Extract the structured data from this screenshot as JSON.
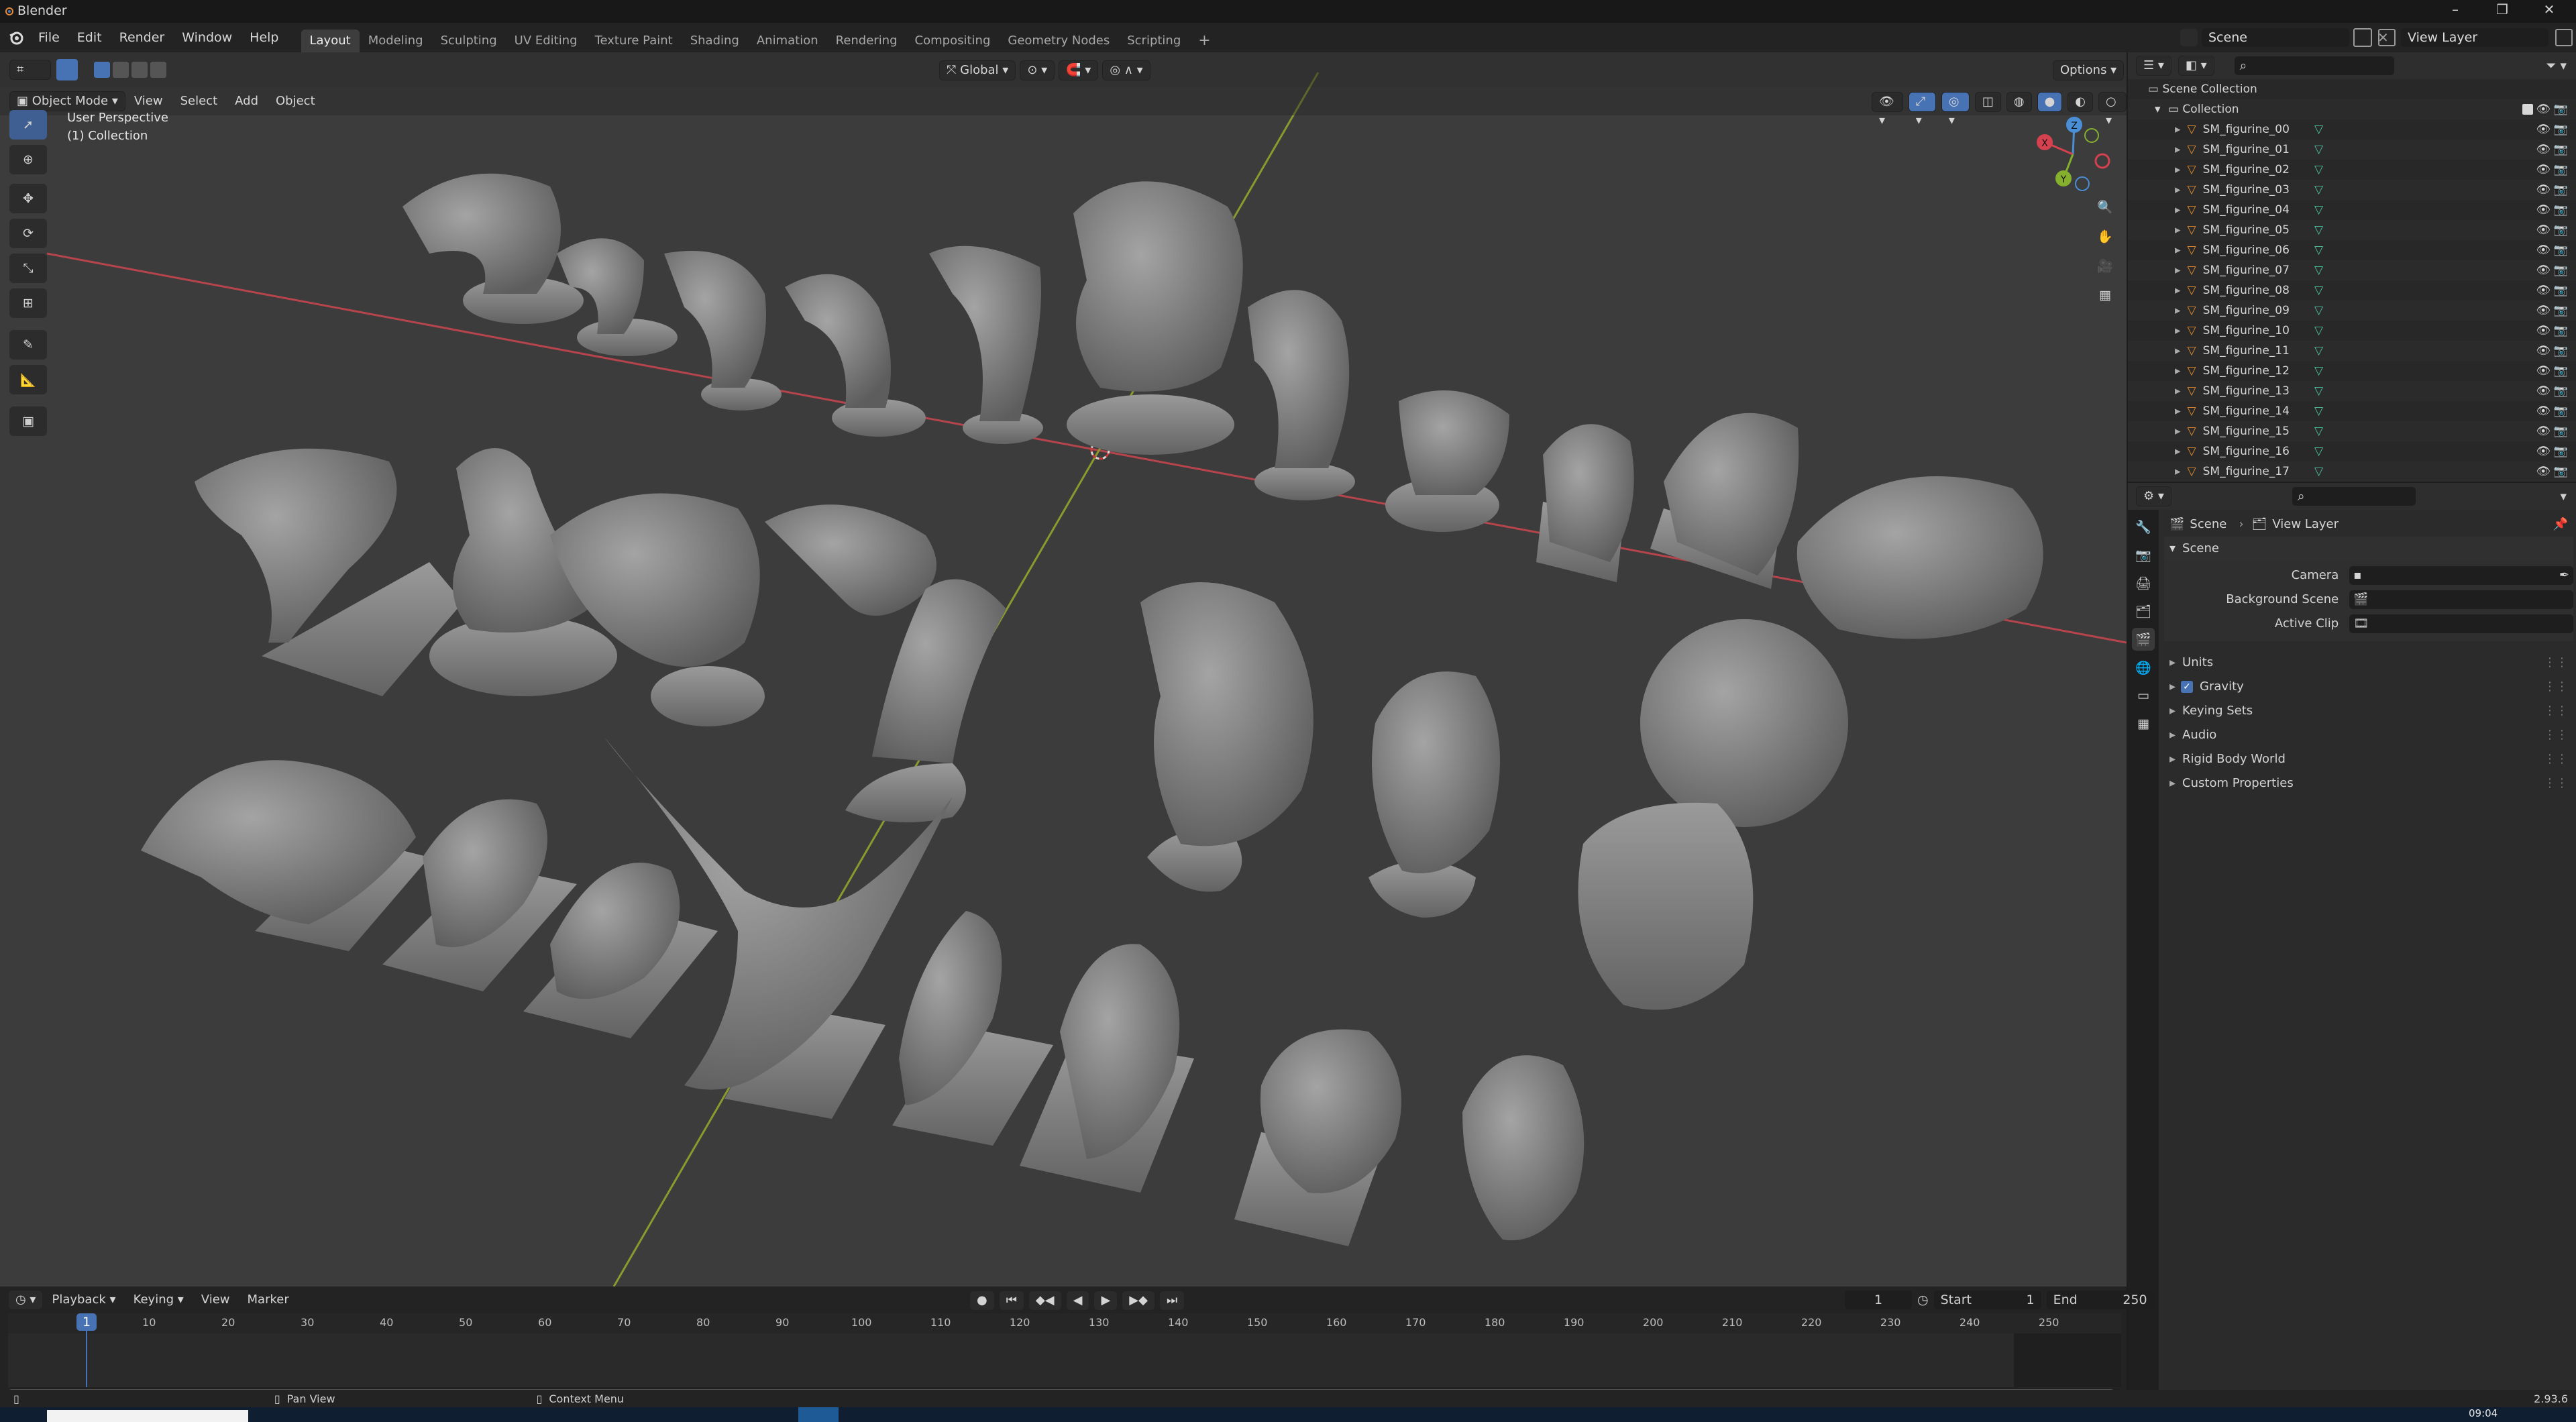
{
  "app": {
    "title": "Blender",
    "version": "2.93.6"
  },
  "menu": [
    "File",
    "Edit",
    "Render",
    "Window",
    "Help"
  ],
  "workspaces": [
    "Layout",
    "Modeling",
    "Sculpting",
    "UV Editing",
    "Texture Paint",
    "Shading",
    "Animation",
    "Rendering",
    "Compositing",
    "Geometry Nodes",
    "Scripting"
  ],
  "active_workspace": "Layout",
  "scene_selector": {
    "scene": "Scene",
    "view_layer": "View Layer"
  },
  "viewport": {
    "mode": "Object Mode",
    "menus": [
      "View",
      "Select",
      "Add",
      "Object"
    ],
    "transform_orientation": "Global",
    "options_label": "Options",
    "overlay_line1": "User Perspective",
    "overlay_line2": "(1) Collection",
    "gizmo": {
      "x": "X",
      "y": "Y",
      "z": "Z"
    }
  },
  "outliner": {
    "root": "Scene Collection",
    "collection": "Collection",
    "objects": [
      "SM_figurine_00",
      "SM_figurine_01",
      "SM_figurine_02",
      "SM_figurine_03",
      "SM_figurine_04",
      "SM_figurine_05",
      "SM_figurine_06",
      "SM_figurine_07",
      "SM_figurine_08",
      "SM_figurine_09",
      "SM_figurine_10",
      "SM_figurine_11",
      "SM_figurine_12",
      "SM_figurine_13",
      "SM_figurine_14",
      "SM_figurine_15",
      "SM_figurine_16",
      "SM_figurine_17"
    ]
  },
  "properties": {
    "breadcrumb_scene": "Scene",
    "breadcrumb_view_layer": "View Layer",
    "section": "Scene",
    "fields": [
      {
        "label": "Camera",
        "value": ""
      },
      {
        "label": "Background Scene",
        "value": ""
      },
      {
        "label": "Active Clip",
        "value": ""
      }
    ],
    "subpanels": [
      "Units",
      "Gravity",
      "Keying Sets",
      "Audio",
      "Rigid Body World",
      "Custom Properties"
    ],
    "gravity_checked": true
  },
  "timeline": {
    "menus": [
      "Playback",
      "Keying",
      "View",
      "Marker"
    ],
    "current_frame": "1",
    "start_label": "Start",
    "start": "1",
    "end_label": "End",
    "end": "250",
    "playhead_label": "1",
    "ticks": [
      "10",
      "20",
      "30",
      "40",
      "50",
      "60",
      "70",
      "80",
      "90",
      "100",
      "110",
      "120",
      "130",
      "140",
      "150",
      "160",
      "170",
      "180",
      "190",
      "200",
      "210",
      "220",
      "230",
      "240",
      "250"
    ]
  },
  "status": {
    "left_hint": "Pan View",
    "right_hint": "Context Menu",
    "version": "2.93.6"
  },
  "taskbar": {
    "time": "09:04"
  },
  "colors": {
    "accent": "#4772b3",
    "active_tool": "#3f5f92",
    "x_axis": "#d5414f",
    "y_axis": "#85b02e",
    "z_axis": "#4a8fd6",
    "mesh_icon": "#e58b2c",
    "vertex_icon": "#4fc2a4"
  }
}
